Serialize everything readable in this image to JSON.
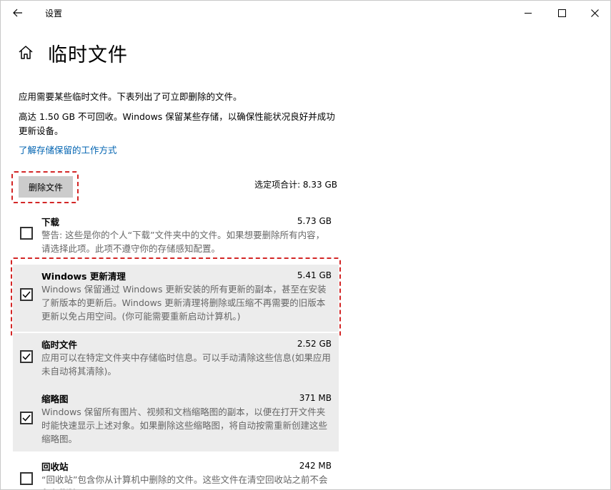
{
  "window": {
    "title": "设置",
    "back_icon": "back-arrow-icon",
    "controls": [
      "minimize-icon",
      "maximize-icon",
      "close-icon"
    ]
  },
  "header": {
    "home_icon": "home-icon",
    "title": "临时文件"
  },
  "intro": {
    "line1": "应用需要某些临时文件。下表列出了可立即删除的文件。",
    "line2": "高达 1.50 GB 不可回收。Windows 保留某些存储，以确保性能状况良好并成功更新设备。",
    "link": "了解存储保留的工作方式"
  },
  "actions": {
    "delete_label": "删除文件",
    "selected_total": "选定项合计: 8.33 GB"
  },
  "items": [
    {
      "name": "下载",
      "size": "5.73 GB",
      "checked": false,
      "desc": "警告: 这些是你的个人“下载”文件夹中的文件。如果想要删除所有内容，请选择此项。此项不遵守你的存储感知配置。"
    },
    {
      "name": "Windows 更新清理",
      "size": "5.41 GB",
      "checked": true,
      "desc": "Windows 保留通过 Windows 更新安装的所有更新的副本，甚至在安装了新版本的更新后。Windows 更新清理将删除或压缩不再需要的旧版本更新以免占用空间。(你可能需要重新启动计算机。)"
    },
    {
      "name": "临时文件",
      "size": "2.52 GB",
      "checked": true,
      "desc": "应用可以在特定文件夹中存储临时信息。可以手动清除这些信息(如果应用未自动将其清除)。"
    },
    {
      "name": "缩略图",
      "size": "371 MB",
      "checked": true,
      "desc": "Windows 保留所有图片、视频和文档缩略图的副本，以便在打开文件夹时能快速显示上述对象。如果删除这些缩略图，将自动按需重新创建这些缩略图。"
    },
    {
      "name": "回收站",
      "size": "242 MB",
      "checked": false,
      "desc": "“回收站”包含你从计算机中删除的文件。这些文件在清空回收站之前不会永久删除。"
    }
  ],
  "colors": {
    "link": "#0063b1",
    "highlight": "#d32626",
    "checked_bg": "#ececec",
    "button_bg": "#cccccc"
  }
}
